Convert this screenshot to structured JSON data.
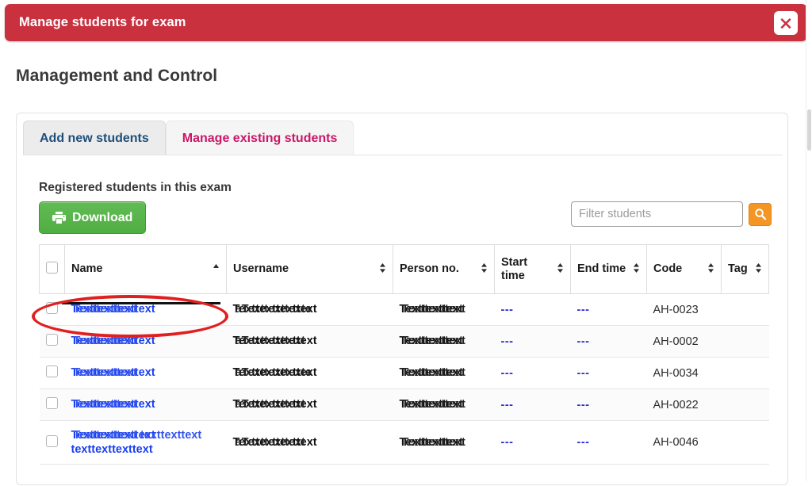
{
  "modal": {
    "title": "Manage students for exam",
    "close_icon": "close-x-icon",
    "header_color": "#c9313f"
  },
  "page": {
    "heading": "Management and Control"
  },
  "tabs": [
    {
      "label": "Add new students",
      "active": false,
      "color": "#1e4f7a"
    },
    {
      "label": "Manage existing students",
      "active": true,
      "color": "#cc1667"
    }
  ],
  "toolbar": {
    "caption": "Registered students in this exam",
    "download_label": "Download",
    "download_icon": "printer-icon",
    "download_color": "#4fae42",
    "filter_placeholder": "Filter students",
    "filter_value": "",
    "search_icon": "search-icon",
    "search_button_color": "#f49524"
  },
  "table": {
    "columns": [
      {
        "key": "check",
        "label": "",
        "sort": "none"
      },
      {
        "key": "name",
        "label": "Name",
        "sort": "asc"
      },
      {
        "key": "user",
        "label": "Username",
        "sort": "both"
      },
      {
        "key": "person",
        "label": "Person no.",
        "sort": "both"
      },
      {
        "key": "start",
        "label": "Start time",
        "sort": "both"
      },
      {
        "key": "end",
        "label": "End time",
        "sort": "both"
      },
      {
        "key": "code",
        "label": "Code",
        "sort": "both"
      },
      {
        "key": "tag",
        "label": "Tag",
        "sort": "both"
      }
    ],
    "rows": [
      {
        "name": "Texttexttexttext",
        "name_alt": "Texttexttext",
        "username": "Texttexttexttext",
        "username_alt": "aTexttexttexte",
        "person": "Texttexttext",
        "person_alt": "Texttexttext",
        "start": "---",
        "end": "---",
        "code": "AH-0023",
        "tag": ""
      },
      {
        "name": "Texttexttexttext",
        "name_alt": "Texttexttext",
        "username": "Texttexttexttext",
        "username_alt": "aTexttexttext",
        "person": "Texttexttext",
        "person_alt": "Texttexttext",
        "start": "---",
        "end": "---",
        "code": "AH-0002",
        "tag": ""
      },
      {
        "name": "Texttexttexttext",
        "name_alt": "Texttexttext",
        "username": "Texttexttexttext",
        "username_alt": "aTexttexttexte",
        "person": "Texttexttext",
        "person_alt": "Texttexttext",
        "start": "---",
        "end": "---",
        "code": "AH-0034",
        "tag": ""
      },
      {
        "name": "Texttexttexttext",
        "name_alt": "Texttexttext",
        "username": "Texttexttexttext",
        "username_alt": "aTexttexttext",
        "person": "Texttexttext",
        "person_alt": "Texttexttext",
        "start": "---",
        "end": "---",
        "code": "AH-0022",
        "tag": ""
      },
      {
        "name": "Texttexttexttext texttexttexttext",
        "name_alt": "Texttexttext texttexttext",
        "username": "Texttexttexttext",
        "username_alt": "aTexttexttext",
        "person": "Texttexttext",
        "person_alt": "Texttexttext",
        "start": "---",
        "end": "---",
        "code": "AH-0046",
        "tag": ""
      }
    ]
  },
  "annotation": {
    "shape": "ellipse",
    "color": "#e02020",
    "target": "first-row-name-cell"
  }
}
